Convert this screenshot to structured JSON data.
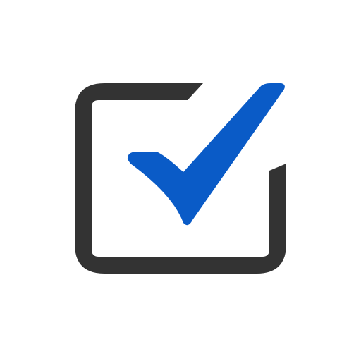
{
  "icon": {
    "name": "checkbox-checked-icon",
    "frame_color": "#333333",
    "check_color": "#0A5BC7",
    "background_color": "#FFFFFF"
  }
}
